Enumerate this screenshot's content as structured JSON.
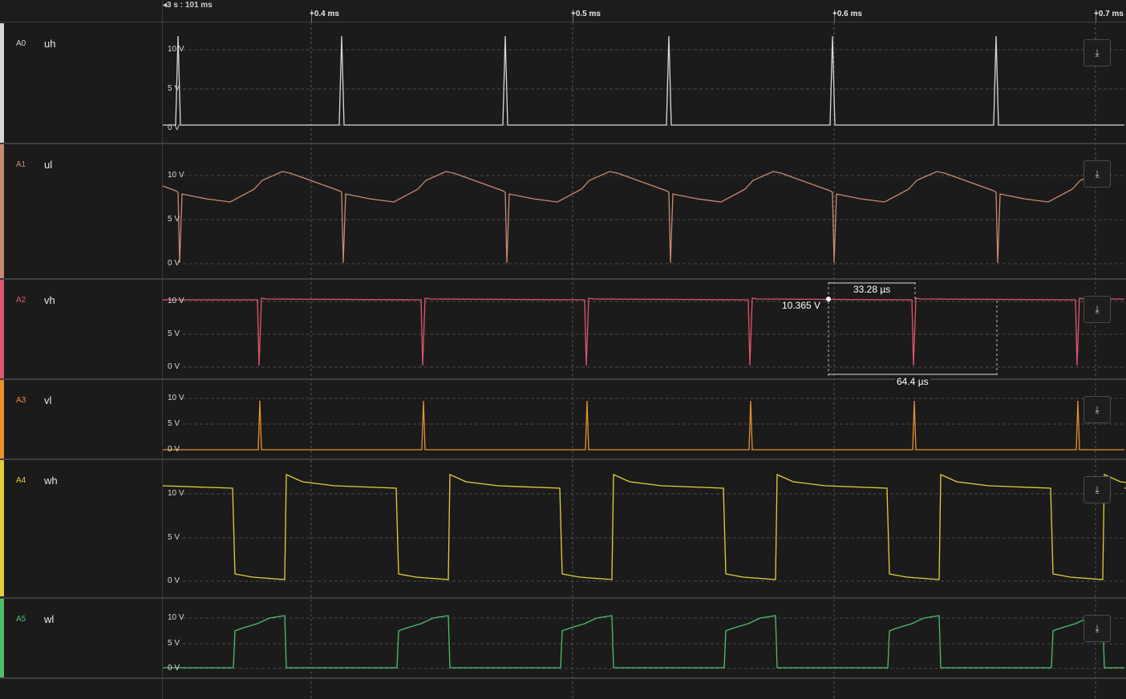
{
  "timeline": {
    "origin_label": "3 s : 101 ms",
    "markers": [
      {
        "label": "+0.4 ms",
        "t": 0.4
      },
      {
        "label": "+0.5 ms",
        "t": 0.5
      },
      {
        "label": "+0.6 ms",
        "t": 0.6
      },
      {
        "label": "+0.7 ms",
        "t": 0.7
      }
    ]
  },
  "channels": [
    {
      "id": "A0",
      "name": "uh",
      "color": "#d8d8d8",
      "labels": [
        "10 V",
        "5 V",
        "0 V"
      ],
      "scale_icon": "vertical-fit-icon"
    },
    {
      "id": "A1",
      "name": "ul",
      "color": "#c98a72",
      "labels": [
        "10 V",
        "5 V",
        "0 V"
      ],
      "scale_icon": "vertical-fit-icon"
    },
    {
      "id": "A2",
      "name": "vh",
      "color": "#e0566f",
      "labels": [
        "10 V",
        "5 V",
        "0 V"
      ],
      "scale_icon": "vertical-fit-icon"
    },
    {
      "id": "A3",
      "name": "vl",
      "color": "#e6922f",
      "labels": [
        "10 V",
        "5 V",
        "0 V"
      ],
      "scale_icon": "vertical-fit-icon"
    },
    {
      "id": "A4",
      "name": "wh",
      "color": "#e3cf3c",
      "labels": [
        "10 V",
        "5 V",
        "0 V"
      ],
      "scale_icon": "vertical-fit-icon"
    },
    {
      "id": "A5",
      "name": "wl",
      "color": "#4fbf6b",
      "labels": [
        "10 V",
        "5 V",
        "0 V"
      ],
      "scale_icon": "vertical-fit-icon"
    }
  ],
  "measurements": {
    "point_value": "10.365 V",
    "width_short": "33.28 µs",
    "width_long": "64.4 µs"
  }
}
